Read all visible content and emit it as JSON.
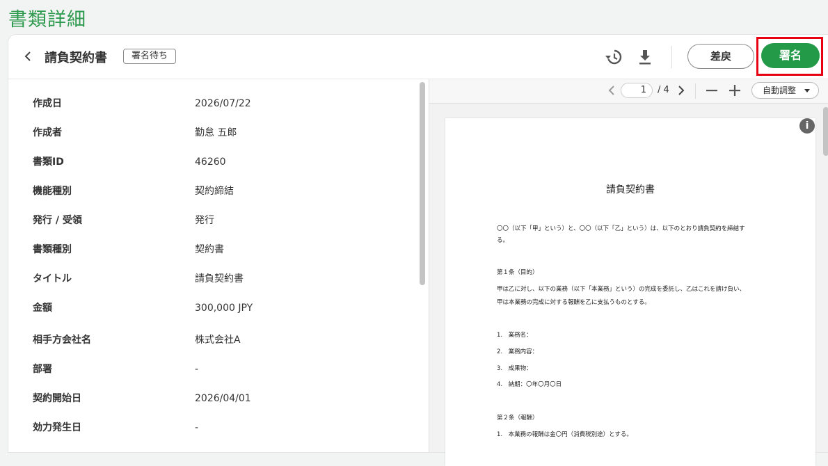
{
  "page": {
    "title": "書類詳細"
  },
  "header": {
    "back_icon": "chevron-left-icon",
    "doc_title": "請負契約書",
    "status": "署名待ち",
    "history_icon": "history-icon",
    "download_icon": "download-icon",
    "return_label": "差戻",
    "sign_label": "署名"
  },
  "properties": [
    {
      "label": "作成日",
      "value": "2026/07/22"
    },
    {
      "label": "作成者",
      "value": "勤怠 五郎"
    },
    {
      "label": "書類ID",
      "value": "46260"
    },
    {
      "label": "機能種別",
      "value": "契約締結"
    },
    {
      "label": "発行 / 受領",
      "value": "発行"
    },
    {
      "label": "書類種別",
      "value": "契約書"
    },
    {
      "label": "タイトル",
      "value": "請負契約書"
    },
    {
      "label": "金額",
      "value": "300,000 JPY"
    },
    {
      "label": "相手方会社名",
      "value": "株式会社A"
    },
    {
      "label": "部署",
      "value": "-"
    },
    {
      "label": "契約開始日",
      "value": "2026/04/01"
    },
    {
      "label": "効力発生日",
      "value": "-"
    }
  ],
  "viewer": {
    "current_page": "1",
    "total_pages": "/ 4",
    "zoom": "自動調整",
    "info_icon": "info-icon",
    "document": {
      "title": "請負契約書",
      "lines": [
        "〇〇（以下「甲」という）と、〇〇（以下「乙」という）は、以下のとおり請負契約を締結す",
        "る。",
        "第１条（目的）",
        "甲は乙に対し、以下の業務（以下「本業務」という）の完成を委託し、乙はこれを請け負い、",
        "甲は本業務の完成に対する報酬を乙に支払うものとする。",
        "1.　業務名：",
        "2.　業務内容：",
        "3.　成果物：",
        "4.　納期：〇年〇月〇日",
        "第２条（報酬）",
        "1.　本業務の報酬は金〇円（消費税別途）とする。"
      ]
    }
  }
}
